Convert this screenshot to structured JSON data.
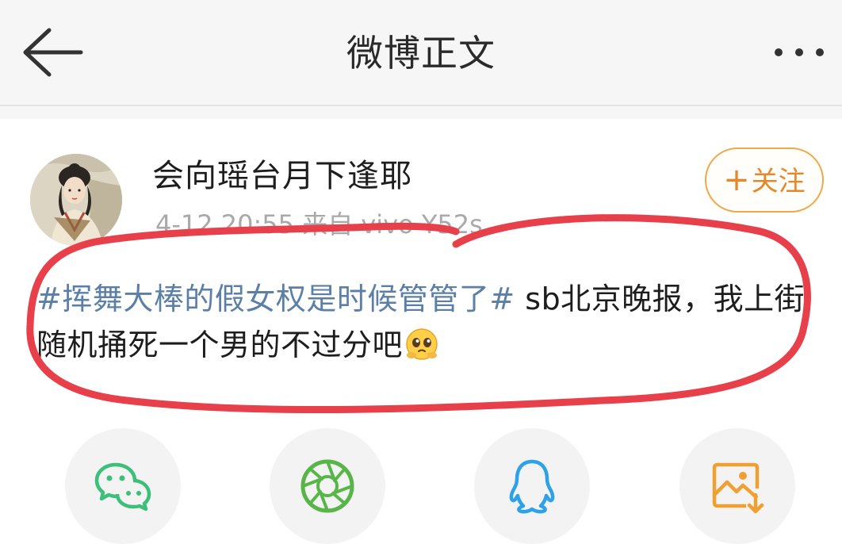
{
  "nav": {
    "title": "微博正文",
    "back_icon": "back-arrow-icon",
    "more_icon": "more-dots-icon"
  },
  "post": {
    "author": {
      "name": "会向瑶台月下逢耶",
      "avatar": "illustrated-woman-avatar"
    },
    "meta": "4-12 20:55  来自 vivo Y52s",
    "follow_label": "关注",
    "hashtag": "#挥舞大棒的假女权是时候管管了#",
    "text": " sb北京晚报，我上街随机捅死一个男的不过分吧",
    "emoji": "pleading-face-emoji",
    "highlight_color": "#e8404a"
  },
  "share": {
    "items": [
      {
        "icon": "wechat-icon",
        "color": "#3cbf7a"
      },
      {
        "icon": "moments-icon",
        "color": "#58b548"
      },
      {
        "icon": "qq-icon",
        "color": "#2ea2e8"
      },
      {
        "icon": "save-image-icon",
        "color": "#f0a030"
      }
    ]
  },
  "colors": {
    "accent": "#f0a848",
    "link": "#5b7fa6",
    "nav_bg": "#f6f6f6"
  }
}
